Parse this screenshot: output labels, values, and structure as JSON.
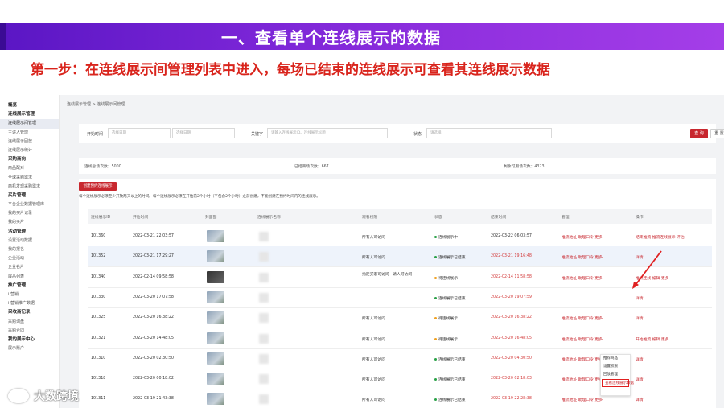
{
  "slide": {
    "title": "一、查看单个连线展示的数据",
    "subtitle": "第一步：在连线展示间管理列表中进入，每场已结束的连线展示可查看其连线展示数据"
  },
  "colors": {
    "accent_red": "#c8272e",
    "banner_purple": "#7a25d6",
    "subtitle_red": "#d9241c"
  },
  "sidebar": {
    "items": [
      {
        "label": "概览",
        "type": "group"
      },
      {
        "label": "连线展示管理",
        "type": "group"
      },
      {
        "label": "连线展示间管理",
        "type": "active"
      },
      {
        "label": "主讲人管理",
        "type": "item"
      },
      {
        "label": "连线展示回放",
        "type": "item"
      },
      {
        "label": "连线展示统计",
        "type": "item"
      },
      {
        "label": "采购商向",
        "type": "group"
      },
      {
        "label": "商品配对",
        "type": "item"
      },
      {
        "label": "全球采购需求",
        "type": "item"
      },
      {
        "label": "商机发现采购需求",
        "type": "item"
      },
      {
        "label": "买片管理",
        "type": "group"
      },
      {
        "label": "平台企业数据管理库",
        "type": "item"
      },
      {
        "label": "我的买片记录",
        "type": "item"
      },
      {
        "label": "我的买片",
        "type": "item"
      },
      {
        "label": "活动管理",
        "type": "group"
      },
      {
        "label": "设置活动数据",
        "type": "item"
      },
      {
        "label": "我的报名",
        "type": "item"
      },
      {
        "label": "企业活动",
        "type": "item"
      },
      {
        "label": "企业名片",
        "type": "item"
      },
      {
        "label": "展品列表",
        "type": "item"
      },
      {
        "label": "推广管理",
        "type": "group"
      },
      {
        "label": "i 营销",
        "type": "item"
      },
      {
        "label": "i 营销推广数据",
        "type": "item"
      },
      {
        "label": "采收商记录",
        "type": "group"
      },
      {
        "label": "采购询盘",
        "type": "item"
      },
      {
        "label": "采购合同",
        "type": "item"
      },
      {
        "label": "我的展示中心",
        "type": "group"
      },
      {
        "label": "展示账户",
        "type": "item"
      }
    ]
  },
  "breadcrumb": "连线展示管理 > 连线展示间管理",
  "filters": {
    "time_label": "开始时间",
    "date_start_placeholder": "选择日期",
    "date_end_placeholder": "选择日期",
    "keyword_label": "关键字",
    "keyword_placeholder": "请输入连线展示ID、连线展示标题",
    "status_label": "状态",
    "status_placeholder": "请选择",
    "search_label": "查 询",
    "reset_label": "重 置"
  },
  "stats": {
    "total": "连线总场次数：5000",
    "ended": "已结束场次数：667",
    "remaining": "剩余可用场次数：4323"
  },
  "create_button": "创建预约连线展示",
  "note": "每个连线展示必须至少开放两天以上的时间。每个连线展示必须在开始前2个小时（不包含2个小时）之前创建，不能创建在预约时间内的连线展示。",
  "columns": [
    "连线展示ID",
    "开始时间",
    "封面图",
    "连线展示名称",
    "观看权限",
    "状态",
    "结束时间",
    "管理",
    "操作"
  ],
  "rows": [
    {
      "id": "101360",
      "start": "2022-03-21 22:03:57",
      "permission": "所有人可访问",
      "status": "连线展示中",
      "status_color": "#2aa148",
      "end": "2022-03-22 06:03:57",
      "end_red": false,
      "manage": "推流地址  助理口令  更多",
      "ops": "结束推流  推流连线展示  评估",
      "highlight": false,
      "thumb": "normal"
    },
    {
      "id": "101352",
      "start": "2022-03-21 17:29:27",
      "permission": "所有人可访问",
      "status": "连线展示已结束",
      "status_color": "#2aa148",
      "end": "2022-03-21 19:16:48",
      "end_red": true,
      "manage": "推流地址  助理口令  更多",
      "ops": "详情",
      "highlight": true,
      "thumb": "normal"
    },
    {
      "id": "101340",
      "start": "2022-02-14 09:58:58",
      "permission": "指定买家可访问 · 请人可访问",
      "status": "待连线展示",
      "status_color": "#f0a020",
      "end": "2022-02-14 11:58:58",
      "end_red": true,
      "manage": "推流地址  助理口令  更多",
      "ops": "推流连线  编辑  更多",
      "highlight": false,
      "thumb": "dark"
    },
    {
      "id": "101330",
      "start": "2022-03-20 17:07:58",
      "permission": "",
      "status": "连线展示已结束",
      "status_color": "#2aa148",
      "end": "2022-03-20 19:07:59",
      "end_red": true,
      "manage": "",
      "ops": "详情",
      "highlight": false,
      "thumb": "normal"
    },
    {
      "id": "101325",
      "start": "2022-03-20 16:38:22",
      "permission": "所有人可访问",
      "status": "待连线展示",
      "status_color": "#f0a020",
      "end": "2022-03-20 16:38:22",
      "end_red": true,
      "manage": "推流地址  助理口令  更多",
      "ops": "详情",
      "highlight": false,
      "thumb": "normal"
    },
    {
      "id": "101321",
      "start": "2022-03-20 14:48:05",
      "permission": "所有人可访问",
      "status": "待连线展示",
      "status_color": "#f0a020",
      "end": "2022-03-20 16:48:05",
      "end_red": true,
      "manage": "推流地址  助理口令  更多",
      "ops": "开始推流  编辑  更多",
      "highlight": false,
      "thumb": "normal"
    },
    {
      "id": "101310",
      "start": "2022-03-20 02:30:50",
      "permission": "所有人可访问",
      "status": "连线展示已结束",
      "status_color": "#2aa148",
      "end": "2022-03-20 04:30:50",
      "end_red": true,
      "manage": "推流地址  助理口令  更多",
      "ops": "详情",
      "highlight": false,
      "thumb": "normal"
    },
    {
      "id": "101318",
      "start": "2022-03-20 00:18:02",
      "permission": "所有人可访问",
      "status": "连线展示已结束",
      "status_color": "#2aa148",
      "end": "2022-03-20 02:18:03",
      "end_red": true,
      "manage": "推流地址  助理口令  更多",
      "ops": "详情",
      "highlight": false,
      "thumb": "normal"
    },
    {
      "id": "101311",
      "start": "2022-03-19 21:43:38",
      "permission": "所有人可访问",
      "status": "连线展示已结束",
      "status_color": "#2aa148",
      "end": "2022-03-19 22:28:38",
      "end_red": true,
      "manage": "推流地址  助理口令  更多",
      "ops": "详情",
      "highlight": false,
      "thumb": "normal"
    }
  ],
  "dropdown": {
    "items": [
      "推荐商品",
      "设置权限",
      "回放管理",
      "查看连线展示数据"
    ],
    "selected_index": 3
  },
  "watermark": "大数跨境"
}
